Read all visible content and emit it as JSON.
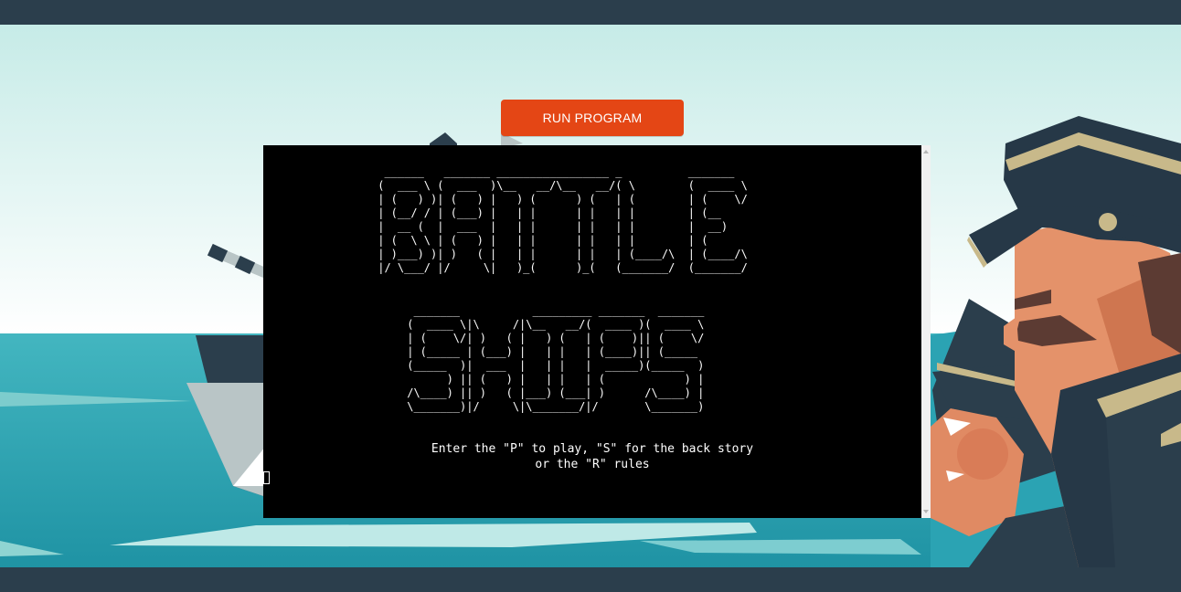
{
  "toolbar": {
    "run_label": "RUN PROGRAM"
  },
  "terminal": {
    "title_line_1": "  ______   _______ _________________ _          _______ \n (  ___ \\ (  ___  )\\__   __/\\__   __/( \\        (  ____ \\\n | (   ) )| (   ) |   ) (      ) (   | (        | (    \\/\n | (__/ / | (___) |   | |      | |   | |        | (__    \n |  __ (  |  ___  |   | |      | |   | |        |  __)   \n | (  \\ \\ | (   ) |   | |      | |   | |        | (      \n | )___) )| )   ( |   | |      | |   | (____/\\  | (____/\\\n |/ \\___/ |/     \\|   )_(      )_(   (_______/  (_______/",
    "title_line_2": "  _______           _________ _______  _______ \n (  ____ \\|\\     /|\\__   __/(  ____ )(  ____ \\\n | (    \\/| )   ( |   ) (   | (    )|| (    \\/\n | (_____ | (___) |   | |   | (____)|| (_____ \n (_____  )|  ___  |   | |   |  _____)(_____  )\n       ) || (   ) |   | |   | (            ) |\n /\\____) || )   ( |___) (___| )      /\\____) |\n \\_______)|/     \\|\\_______/|/       \\_______)",
    "prompt": "Enter the \"P\" to play, \"S\" for the back story\nor the \"R\" rules"
  },
  "colors": {
    "accent": "#e44615",
    "bar": "#2b3e4c",
    "sea": "#2ba3b3",
    "sky": "#c8ebe8",
    "terminal_bg": "#000000"
  },
  "icons": {
    "cursor": "text-cursor-block"
  }
}
